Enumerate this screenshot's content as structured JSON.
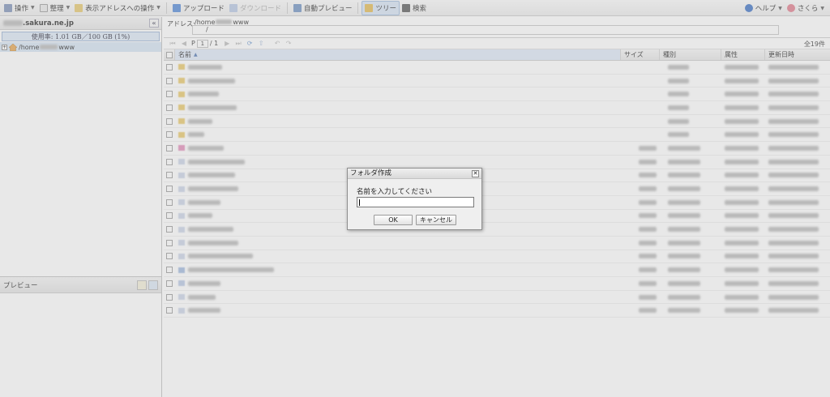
{
  "toolbar": {
    "operate": "操作",
    "organize": "整理",
    "addr_ops": "表示アドレスへの操作",
    "upload": "アップロード",
    "download": "ダウンロード",
    "auto_preview": "自動プレビュー",
    "tree": "ツリー",
    "search": "検索",
    "help": "ヘルプ",
    "user": "さくら"
  },
  "left": {
    "domain_suffix": ".sakura.ne.jp",
    "collapse": "«",
    "usage": "使用率: 1.01 GB／100 GB (1%)",
    "tree_home_prefix": "/home",
    "tree_home_suffix": "www",
    "preview_title": "プレビュー"
  },
  "address": {
    "label": "アドレス:",
    "path_prefix": "/home",
    "path_suffix": "www",
    "sub_path": "/"
  },
  "pager": {
    "page_label": "P",
    "page_value": "1",
    "page_total": "/ 1",
    "count": "全19件"
  },
  "grid": {
    "col_name": "名前",
    "col_size": "サイズ",
    "col_type": "種別",
    "col_attr": "属性",
    "col_date": "更新日時",
    "row_count": 19
  },
  "dialog": {
    "title": "フォルダ作成",
    "message": "名前を入力してください",
    "ok": "OK",
    "cancel": "キャンセル",
    "input_value": ""
  }
}
